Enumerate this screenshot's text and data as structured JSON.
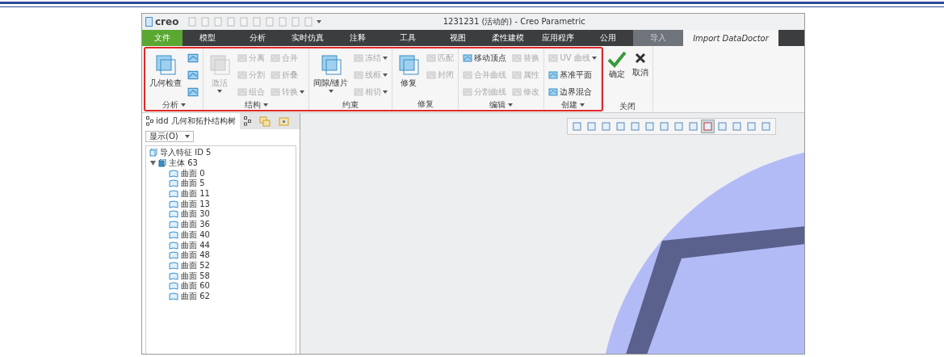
{
  "window": {
    "app_name": "creo",
    "title": "1231231 (活动的) - Creo Parametric"
  },
  "menu_tabs": [
    {
      "label": "文件",
      "kind": "file",
      "selected": false
    },
    {
      "label": "模型",
      "kind": "normal",
      "selected": false
    },
    {
      "label": "分析",
      "kind": "normal",
      "selected": false
    },
    {
      "label": "实时仿真",
      "kind": "normal",
      "selected": false
    },
    {
      "label": "注释",
      "kind": "normal",
      "selected": false
    },
    {
      "label": "工具",
      "kind": "normal",
      "selected": false
    },
    {
      "label": "视图",
      "kind": "normal",
      "selected": false
    },
    {
      "label": "柔性建模",
      "kind": "normal",
      "selected": false
    },
    {
      "label": "应用程序",
      "kind": "normal",
      "selected": false
    },
    {
      "label": "公用",
      "kind": "normal",
      "selected": false
    },
    {
      "label": "导入",
      "kind": "context",
      "selected": false
    },
    {
      "label": "Import DataDoctor",
      "kind": "normal",
      "selected": true
    }
  ],
  "ribbon": {
    "groups": [
      {
        "label": "分析",
        "has_menu": true,
        "outlined": true,
        "columns": [
          [
            {
              "kind": "large",
              "label": "几何检查",
              "disabled": false,
              "has_menu": false
            }
          ],
          [
            {
              "kind": "icon",
              "disabled": false
            },
            {
              "kind": "icon",
              "disabled": false
            },
            {
              "kind": "icon",
              "disabled": false
            }
          ]
        ]
      },
      {
        "label": "结构",
        "has_menu": true,
        "outlined": true,
        "columns": [
          [
            {
              "kind": "large",
              "label": "激活",
              "disabled": true,
              "has_menu": true
            }
          ],
          [
            {
              "kind": "small",
              "label": "分离",
              "disabled": true,
              "has_menu": false
            },
            {
              "kind": "small",
              "label": "分割",
              "disabled": true,
              "has_menu": false
            },
            {
              "kind": "small",
              "label": "组合",
              "disabled": true,
              "has_menu": false
            }
          ],
          [
            {
              "kind": "small",
              "label": "合并",
              "disabled": true,
              "has_menu": false
            },
            {
              "kind": "small",
              "label": "折叠",
              "disabled": true,
              "has_menu": false
            },
            {
              "kind": "small",
              "label": "转换",
              "disabled": true,
              "has_menu": true
            }
          ]
        ]
      },
      {
        "label": "约束",
        "has_menu": false,
        "outlined": true,
        "columns": [
          [
            {
              "kind": "large",
              "label": "间隙/缝片",
              "disabled": false,
              "has_menu": true
            }
          ],
          [
            {
              "kind": "small",
              "label": "冻结",
              "disabled": true,
              "has_menu": true
            },
            {
              "kind": "small",
              "label": "线框",
              "disabled": true,
              "has_menu": true
            },
            {
              "kind": "small",
              "label": "相切",
              "disabled": true,
              "has_menu": true
            }
          ]
        ]
      },
      {
        "label": "修复",
        "has_menu": false,
        "outlined": true,
        "columns": [
          [
            {
              "kind": "large",
              "label": "修复",
              "disabled": false,
              "has_menu": false
            }
          ],
          [
            {
              "kind": "small",
              "label": "匹配",
              "disabled": true,
              "has_menu": false
            },
            {
              "kind": "small",
              "label": "封闭",
              "disabled": true,
              "has_menu": false
            }
          ]
        ]
      },
      {
        "label": "编辑",
        "has_menu": true,
        "outlined": true,
        "columns": [
          [
            {
              "kind": "small",
              "label": "移动顶点",
              "disabled": false,
              "has_menu": false
            },
            {
              "kind": "small",
              "label": "合并曲线",
              "disabled": true,
              "has_menu": false
            },
            {
              "kind": "small",
              "label": "分割曲线",
              "disabled": true,
              "has_menu": false
            }
          ],
          [
            {
              "kind": "small",
              "label": "替换",
              "disabled": true,
              "has_menu": false
            },
            {
              "kind": "small",
              "label": "属性",
              "disabled": true,
              "has_menu": false
            },
            {
              "kind": "small",
              "label": "修改",
              "disabled": true,
              "has_menu": false
            }
          ]
        ]
      },
      {
        "label": "创建",
        "has_menu": true,
        "outlined": true,
        "columns": [
          [
            {
              "kind": "small",
              "label": "UV 曲线",
              "disabled": true,
              "has_menu": true
            },
            {
              "kind": "small",
              "label": "基准平面",
              "disabled": false,
              "has_menu": false
            },
            {
              "kind": "small",
              "label": "边界混合",
              "disabled": false,
              "has_menu": false
            }
          ]
        ]
      },
      {
        "label": "关闭",
        "has_menu": false,
        "outlined": false,
        "columns": [
          [
            {
              "kind": "ok",
              "label": "确定",
              "disabled": false,
              "has_menu": false
            }
          ],
          [
            {
              "kind": "cancel",
              "label": "取消",
              "disabled": false,
              "has_menu": false
            }
          ]
        ]
      }
    ]
  },
  "panel_tabs": [
    {
      "kind": "tree",
      "label": "idd 几何和拓扑结构树",
      "selected": true
    },
    {
      "kind": "tree",
      "selected": false
    },
    {
      "kind": "layers",
      "selected": false
    },
    {
      "kind": "folder",
      "selected": false
    }
  ],
  "display_menu": {
    "label": "显示(O)"
  },
  "tree": [
    {
      "label": "导入特征 ID 5",
      "kind": "feature"
    },
    {
      "label": "主体 63",
      "kind": "body",
      "expanded": true,
      "children": [
        {
          "label": "曲面 0",
          "kind": "surface"
        },
        {
          "label": "曲面 5",
          "kind": "surface"
        },
        {
          "label": "曲面 11",
          "kind": "surface"
        },
        {
          "label": "曲面 13",
          "kind": "surface"
        },
        {
          "label": "曲面 30",
          "kind": "surface"
        },
        {
          "label": "曲面 36",
          "kind": "surface"
        },
        {
          "label": "曲面 40",
          "kind": "surface"
        },
        {
          "label": "曲面 44",
          "kind": "surface"
        },
        {
          "label": "曲面 48",
          "kind": "surface"
        },
        {
          "label": "曲面 52",
          "kind": "surface"
        },
        {
          "label": "曲面 58",
          "kind": "surface"
        },
        {
          "label": "曲面 60",
          "kind": "surface"
        },
        {
          "label": "曲面 62",
          "kind": "surface"
        }
      ]
    }
  ],
  "view_toolbar": [
    {
      "selected": false
    },
    {
      "selected": false
    },
    {
      "selected": false
    },
    {
      "selected": false
    },
    {
      "selected": false
    },
    {
      "selected": false
    },
    {
      "selected": false
    },
    {
      "selected": false
    },
    {
      "selected": false
    },
    {
      "selected": true
    },
    {
      "selected": false
    },
    {
      "selected": false
    },
    {
      "selected": false
    },
    {
      "selected": false
    }
  ]
}
